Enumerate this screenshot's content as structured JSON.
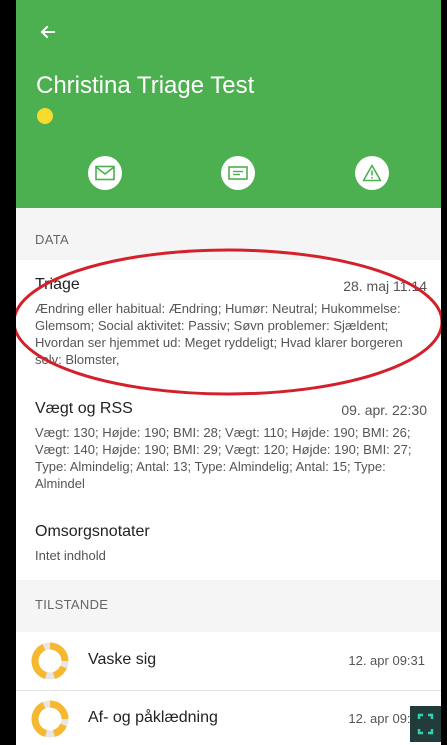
{
  "header": {
    "title": "Christina Triage Test",
    "status_color": "#f7dc2e",
    "background": "#4caf50"
  },
  "actions": [
    {
      "icon": "envelope-icon"
    },
    {
      "icon": "id-card-icon"
    },
    {
      "icon": "warning-icon"
    }
  ],
  "data_section": {
    "label": "DATA",
    "items": [
      {
        "title": "Triage",
        "time": "28. maj 11:14",
        "body": "Ændring eller habitual: Ændring; Humør: Neutral; Hukommelse: Glemsom; Social aktivitet: Passiv; Søvn problemer: Sjældent; Hvordan ser hjemmet ud: Meget ryddeligt; Hvad klarer borgeren selv: Blomster,"
      },
      {
        "title": "Vægt og RSS",
        "time": "09. apr. 22:30",
        "body": "Vægt: 130; Højde: 190; BMI: 28; Vægt: 110; Højde: 190; BMI: 26; Vægt: 140; Højde: 190; BMI: 29; Vægt: 120; Højde: 190; BMI: 27; Type: Almindelig; Antal: 13; Type: Almindelig; Antal: 15; Type: Almindel"
      },
      {
        "title": "Omsorgsnotater",
        "time": "",
        "body": "Intet indhold"
      }
    ]
  },
  "conditions_section": {
    "label": "TILSTANDE",
    "items": [
      {
        "label": "Vaske sig",
        "time": "12. apr 09:31"
      },
      {
        "label": "Af- og påklædning",
        "time": "12. apr 09:31"
      }
    ]
  },
  "colors": {
    "accent_green": "#4caf50",
    "ring_yellow": "#f5b82e",
    "annotation_red": "#d3202b"
  }
}
